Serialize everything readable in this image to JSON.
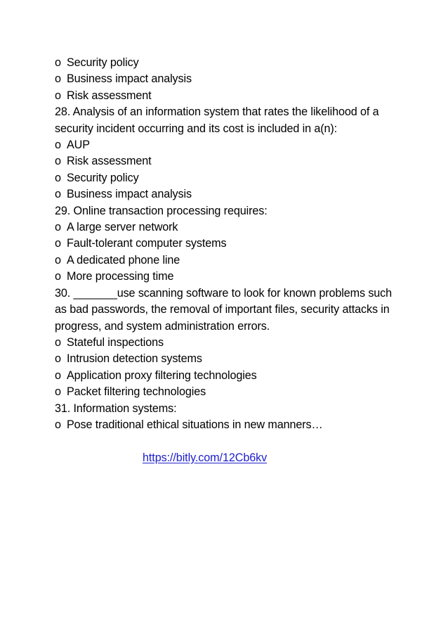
{
  "document": {
    "background_color": "#ffffff",
    "text_color": "#000000",
    "link_color": "#2020cc",
    "blocks": [
      {
        "type": "option",
        "marker": "o",
        "text": "Security policy"
      },
      {
        "type": "option",
        "marker": "o",
        "text": "Business impact analysis"
      },
      {
        "type": "option",
        "marker": "o",
        "text": "Risk assessment"
      },
      {
        "type": "question",
        "text": "28.  Analysis of an information system that rates the likelihood of a security incident occurring and its cost is included in a(n):"
      },
      {
        "type": "option",
        "marker": "o",
        "text": "AUP"
      },
      {
        "type": "option",
        "marker": "o",
        "text": "Risk assessment"
      },
      {
        "type": "option",
        "marker": "o",
        "text": "Security policy"
      },
      {
        "type": "option",
        "marker": "o",
        "text": "Business impact analysis"
      },
      {
        "type": "question",
        "text": "29.  Online transaction processing requires:"
      },
      {
        "type": "option",
        "marker": "o",
        "text": "A large server network"
      },
      {
        "type": "option",
        "marker": "o",
        "text": "Fault-tolerant computer systems"
      },
      {
        "type": "option",
        "marker": "o",
        "text": "A dedicated phone line"
      },
      {
        "type": "option",
        "marker": "o",
        "text": "More processing time"
      },
      {
        "type": "question",
        "text": "30.  _______use scanning software to look for known problems such as bad passwords, the removal of important files, security attacks in progress, and system administration errors."
      },
      {
        "type": "option",
        "marker": "o",
        "text": "Stateful inspections"
      },
      {
        "type": "option",
        "marker": "o",
        "text": "Intrusion detection systems"
      },
      {
        "type": "option",
        "marker": "o",
        "text": "Application proxy filtering technologies"
      },
      {
        "type": "option",
        "marker": "o",
        "text": "Packet filtering technologies"
      },
      {
        "type": "question",
        "text": "31.  Information systems:"
      },
      {
        "type": "option",
        "marker": "o",
        "text": "Pose traditional ethical situations in new manners…"
      }
    ],
    "link": {
      "text": "https://bitly.com/12Cb6kv"
    }
  }
}
